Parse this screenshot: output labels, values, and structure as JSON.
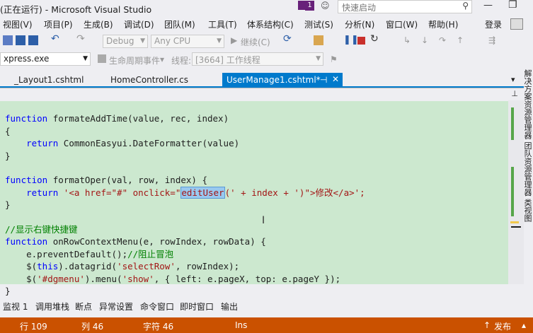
{
  "window": {
    "title": "(正在运行) - Microsoft Visual Studio",
    "badge": "1",
    "quick_launch_placeholder": "快速启动",
    "min_symbol": "—",
    "restore_symbol": "❐"
  },
  "menu": {
    "items": [
      "视图(V)",
      "项目(P)",
      "生成(B)",
      "调试(D)",
      "团队(M)",
      "工具(T)",
      "体系结构(C)",
      "测试(S)",
      "分析(N)",
      "窗口(W)",
      "帮助(H)"
    ],
    "login": "登录"
  },
  "toolbar": {
    "config": "Debug",
    "platform": "Any CPU",
    "continue": "继续(C)"
  },
  "debugbar": {
    "process": "xpress.exe",
    "lifecycle": "生命周期事件",
    "thread_label": "线程:",
    "thread_value": "[3664] 工作线程"
  },
  "tabs": [
    {
      "label": "_Layout1.cshtml"
    },
    {
      "label": "HomeController.cs"
    },
    {
      "label": "UserManage1.cshtml*",
      "active": true
    }
  ],
  "code": {
    "l1a": "function",
    "l1b": " formateAddTime(value, rec, index)",
    "l2": "{",
    "l3a": "    return",
    "l3b": " CommonEasyui.DateFormatter(value)",
    "l4": "}",
    "l6a": "function",
    "l6b": " formatOper(val, row, index) {",
    "l7a": "    return",
    "l7b": " '<a href=\"#\" onclick=\"",
    "l7c": "editUser",
    "l7d": "(' + index + ')\">修改</a>';",
    "l8": "}",
    "l10": "//显示右键快捷键",
    "l11a": "function",
    "l11b": " onRowContextMenu(e, rowIndex, rowData) {",
    "l12a": "    e.preventDefault();",
    "l12b": "//阻止冒泡",
    "l13a": "    $(",
    "l13b": "this",
    "l13c": ").datagrid(",
    "l13d": "'selectRow'",
    "l13e": ", rowIndex);",
    "l14a": "    $(",
    "l14b": "'#dgmenu'",
    "l14c": ").menu(",
    "l14d": "'show'",
    "l14e": ", { left: e.pageX, top: e.pageY });",
    "l15": "}"
  },
  "side_panel": {
    "text": "解决方案资源管理器 团队资源管理器 类视图"
  },
  "bottom_tabs": [
    "监视 1",
    "调用堆栈",
    "断点",
    "异常设置",
    "命令窗口",
    "即时窗口",
    "输出"
  ],
  "status": {
    "line": "行 109",
    "col": "列 46",
    "char": "字符 46",
    "mode": "Ins",
    "publish": "发布"
  },
  "colors": {
    "accent": "#007acc",
    "status_bar": "#ca5100",
    "editor_bg": "#cce8cf"
  }
}
